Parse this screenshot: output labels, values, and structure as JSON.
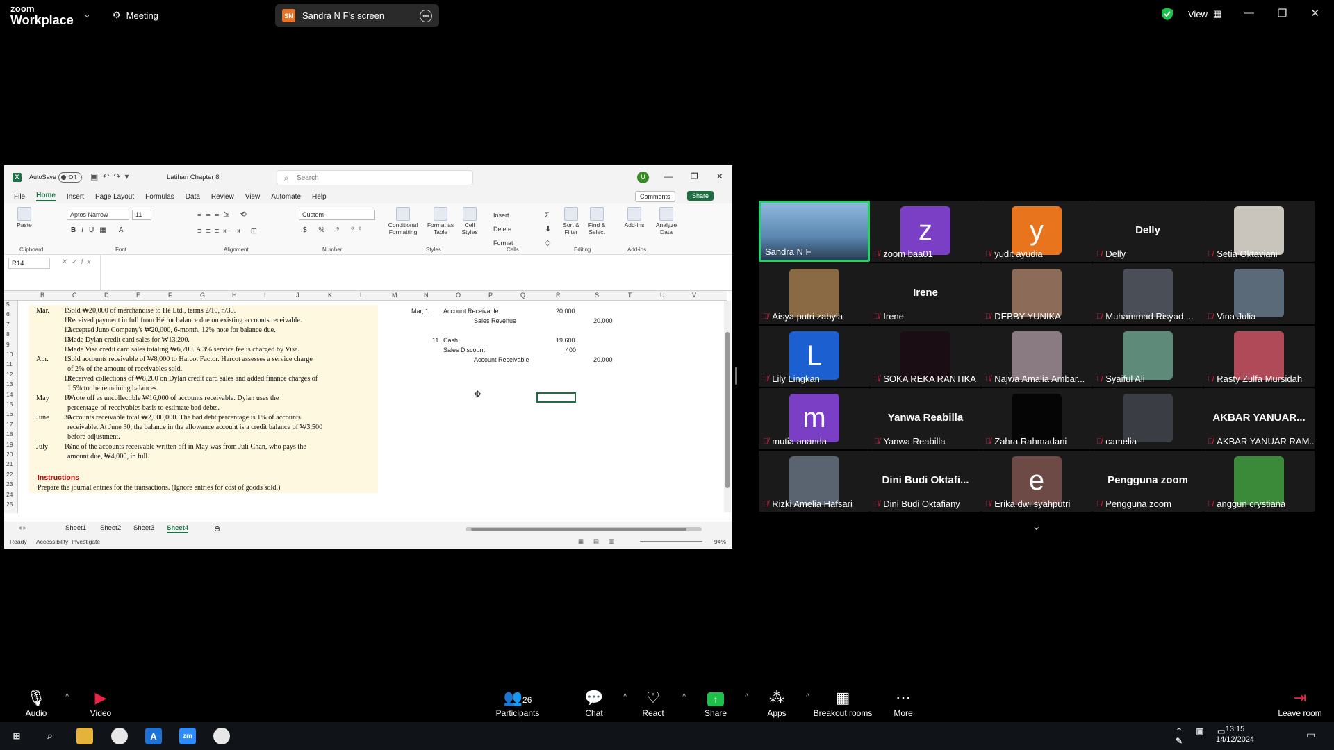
{
  "zoom": {
    "brand_top": "zoom",
    "brand_bottom": "Workplace",
    "meeting_label": "Meeting",
    "share_badge": "SN",
    "share_title": "Sandra N F's screen",
    "view_label": "View",
    "participant_count": "26",
    "toolbar": [
      {
        "label": "Audio",
        "icon": "mic-icon"
      },
      {
        "label": "Video",
        "icon": "video-off-icon"
      },
      {
        "label": "Participants",
        "icon": "participants-icon"
      },
      {
        "label": "Chat",
        "icon": "chat-icon"
      },
      {
        "label": "React",
        "icon": "react-icon"
      },
      {
        "label": "Share",
        "icon": "share-icon"
      },
      {
        "label": "Apps",
        "icon": "apps-icon"
      },
      {
        "label": "Breakout rooms",
        "icon": "breakout-icon"
      },
      {
        "label": "More",
        "icon": "more-icon"
      },
      {
        "label": "Leave room",
        "icon": "leave-icon"
      }
    ],
    "accent": "#24d26a",
    "share_green": "#1fbf4b"
  },
  "excel": {
    "autosave": "AutoSave",
    "autosave_state": "Off",
    "file_name": "Latihan Chapter 8",
    "search_placeholder": "Search",
    "avatar": "U",
    "menu": [
      "File",
      "Home",
      "Insert",
      "Page Layout",
      "Formulas",
      "Data",
      "Review",
      "View",
      "Automate",
      "Help"
    ],
    "comments": "Comments",
    "share": "Share",
    "font_name": "Aptos Narrow",
    "font_size": "11",
    "number_format": "Custom",
    "ribbon": {
      "paste": "Paste",
      "clipboard": "Clipboard",
      "font": "Font",
      "alignment": "Alignment",
      "number": "Number",
      "conditional": "Conditional Formatting",
      "format_table": "Format as Table",
      "cell_styles": "Cell Styles",
      "styles": "Styles",
      "insert": "Insert",
      "delete": "Delete",
      "format": "Format",
      "cells": "Cells",
      "sort": "Sort & Filter",
      "find": "Find & Select",
      "editing": "Editing",
      "addins": "Add-ins",
      "analyze": "Analyze Data",
      "addins_group": "Add-ins"
    },
    "name_box": "R14",
    "columns": [
      "B",
      "C",
      "D",
      "E",
      "F",
      "G",
      "H",
      "I",
      "J",
      "K",
      "L",
      "M",
      "N",
      "O",
      "P",
      "Q",
      "R",
      "S",
      "T",
      "U",
      "V"
    ],
    "rows": [
      "5",
      "6",
      "7",
      "8",
      "9",
      "10",
      "11",
      "12",
      "13",
      "14",
      "15",
      "16",
      "17",
      "18",
      "19",
      "20",
      "21",
      "22",
      "23",
      "24",
      "25"
    ],
    "problem_lines": [
      {
        "d": "Mar.",
        "n": "1",
        "t": "Sold ₩20,000 of merchandise to Hé Ltd., terms 2/10, n/30."
      },
      {
        "d": "",
        "n": "11",
        "t": "Received payment in full from Hé for balance due on existing accounts receivable."
      },
      {
        "d": "",
        "n": "12",
        "t": "Accepted Juno Company's ₩20,000, 6-month, 12% note for balance due."
      },
      {
        "d": "",
        "n": "13",
        "t": "Made Dylan credit card sales for ₩13,200."
      },
      {
        "d": "",
        "n": "15",
        "t": "Made Visa credit card sales totaling ₩6,700. A 3% service fee is charged by Visa."
      },
      {
        "d": "Apr.",
        "n": "11",
        "t": "Sold accounts receivable of ₩8,000 to Harcot Factor. Harcot assesses a service charge"
      },
      {
        "d": "",
        "n": "",
        "t": "of 2% of the amount of receivables sold."
      },
      {
        "d": "",
        "n": "13",
        "t": "Received collections of ₩8,200 on Dylan credit card sales and added finance charges of"
      },
      {
        "d": "",
        "n": "",
        "t": "1.5% to the remaining balances."
      },
      {
        "d": "May",
        "n": "10",
        "t": "Wrote off as uncollectible ₩16,000 of accounts receivable. Dylan uses the"
      },
      {
        "d": "",
        "n": "",
        "t": "percentage-of-receivables basis to estimate bad debts."
      },
      {
        "d": "June",
        "n": "30",
        "t": "Accounts receivable total ₩2,000,000. The bad debt percentage is 1% of accounts"
      },
      {
        "d": "",
        "n": "",
        "t": "receivable. At June 30, the balance in the allowance account is a credit balance of ₩3,500"
      },
      {
        "d": "",
        "n": "",
        "t": "before adjustment."
      },
      {
        "d": "July",
        "n": "16",
        "t": "One of the accounts receivable written off in May was from Juli Chan, who pays the"
      },
      {
        "d": "",
        "n": "",
        "t": "amount due, ₩4,000, in full."
      }
    ],
    "instructions_title": "Instructions",
    "instructions_text": "Prepare the journal entries for the transactions. (Ignore entries for cost of goods sold.)",
    "journal": {
      "e1_date": "Mar, 1",
      "e1_debit_acct": "Account Receivable",
      "e1_debit_amt": "20.000",
      "e1_credit_acct": "Sales Revenue",
      "e1_credit_amt": "20.000",
      "e2_date": "11",
      "e2_debit1_acct": "Cash",
      "e2_debit1_amt": "19.600",
      "e2_debit2_acct": "Sales Discount",
      "e2_debit2_amt": "400",
      "e2_credit_acct": "Account Receivable",
      "e2_credit_amt": "20.000"
    },
    "sheets": [
      "Sheet1",
      "Sheet2",
      "Sheet3",
      "Sheet4"
    ],
    "active_sheet": "Sheet4",
    "status_ready": "Ready",
    "accessibility": "Accessibility: Investigate",
    "zoom_level": "94%",
    "green": "#1d6f42"
  },
  "participants": [
    {
      "name": "Sandra N F",
      "big": "",
      "letter": "",
      "color": "#4a6a8a",
      "active": true
    },
    {
      "name": "zoom baa01",
      "big": "",
      "letter": "z",
      "color": "#7b3fc6"
    },
    {
      "name": "yudit ayudia",
      "big": "",
      "letter": "y",
      "color": "#e8741e"
    },
    {
      "name": "Delly",
      "big": "Delly",
      "letter": "",
      "color": ""
    },
    {
      "name": "Setia Oktaviani",
      "big": "",
      "letter": "",
      "color": "#c9c4bc"
    },
    {
      "name": "Aisya putri zabyla",
      "big": "",
      "letter": "",
      "color": "#8a6a44"
    },
    {
      "name": "Irene",
      "big": "Irene",
      "letter": "",
      "color": ""
    },
    {
      "name": "DEBBY YUNIKA",
      "big": "",
      "letter": "",
      "color": "#8c6c58"
    },
    {
      "name": "Muhammad Risyad ...",
      "big": "",
      "letter": "",
      "color": "#4a4e56"
    },
    {
      "name": "Vina Julia",
      "big": "",
      "letter": "",
      "color": "#5a6a78"
    },
    {
      "name": "Lily Lingkan",
      "big": "",
      "letter": "L",
      "color": "#1c5fd0"
    },
    {
      "name": "SOKA REKA RANTIKA",
      "big": "",
      "letter": "",
      "color": "#1a0d14"
    },
    {
      "name": "Najwa Amalia Ambar...",
      "big": "",
      "letter": "",
      "color": "#8a7a82"
    },
    {
      "name": "Syaiful Ali",
      "big": "",
      "letter": "",
      "color": "#5e8a7a"
    },
    {
      "name": "Rasty Zulfa Mursidah",
      "big": "",
      "letter": "",
      "color": "#b04a58"
    },
    {
      "name": "mutia ananda",
      "big": "",
      "letter": "m",
      "color": "#7b3fc6"
    },
    {
      "name": "Yanwa Reabilla",
      "big": "Yanwa Reabilla",
      "letter": "",
      "color": ""
    },
    {
      "name": "Zahra Rahmadani",
      "big": "",
      "letter": "",
      "color": "#050505"
    },
    {
      "name": "camelia",
      "big": "",
      "letter": "",
      "color": "#3a3e44"
    },
    {
      "name": "AKBAR YANUAR RAM...",
      "big": "AKBAR YANUAR...",
      "letter": "",
      "color": ""
    },
    {
      "name": "Rizki Amelia Hafsari",
      "big": "",
      "letter": "",
      "color": "#5a6470"
    },
    {
      "name": "Dini Budi Oktafiany",
      "big": "Dini Budi Oktafi...",
      "letter": "",
      "color": ""
    },
    {
      "name": "Erika dwi syahputri",
      "big": "",
      "letter": "e",
      "color": "#6e4a46"
    },
    {
      "name": "Pengguna zoom",
      "big": "Pengguna zoom",
      "letter": "",
      "color": ""
    },
    {
      "name": "anggun crystiana",
      "big": "",
      "letter": "",
      "color": "#3a8a3a"
    }
  ],
  "taskbar": {
    "time": "13:15",
    "date": "14/12/2024"
  }
}
